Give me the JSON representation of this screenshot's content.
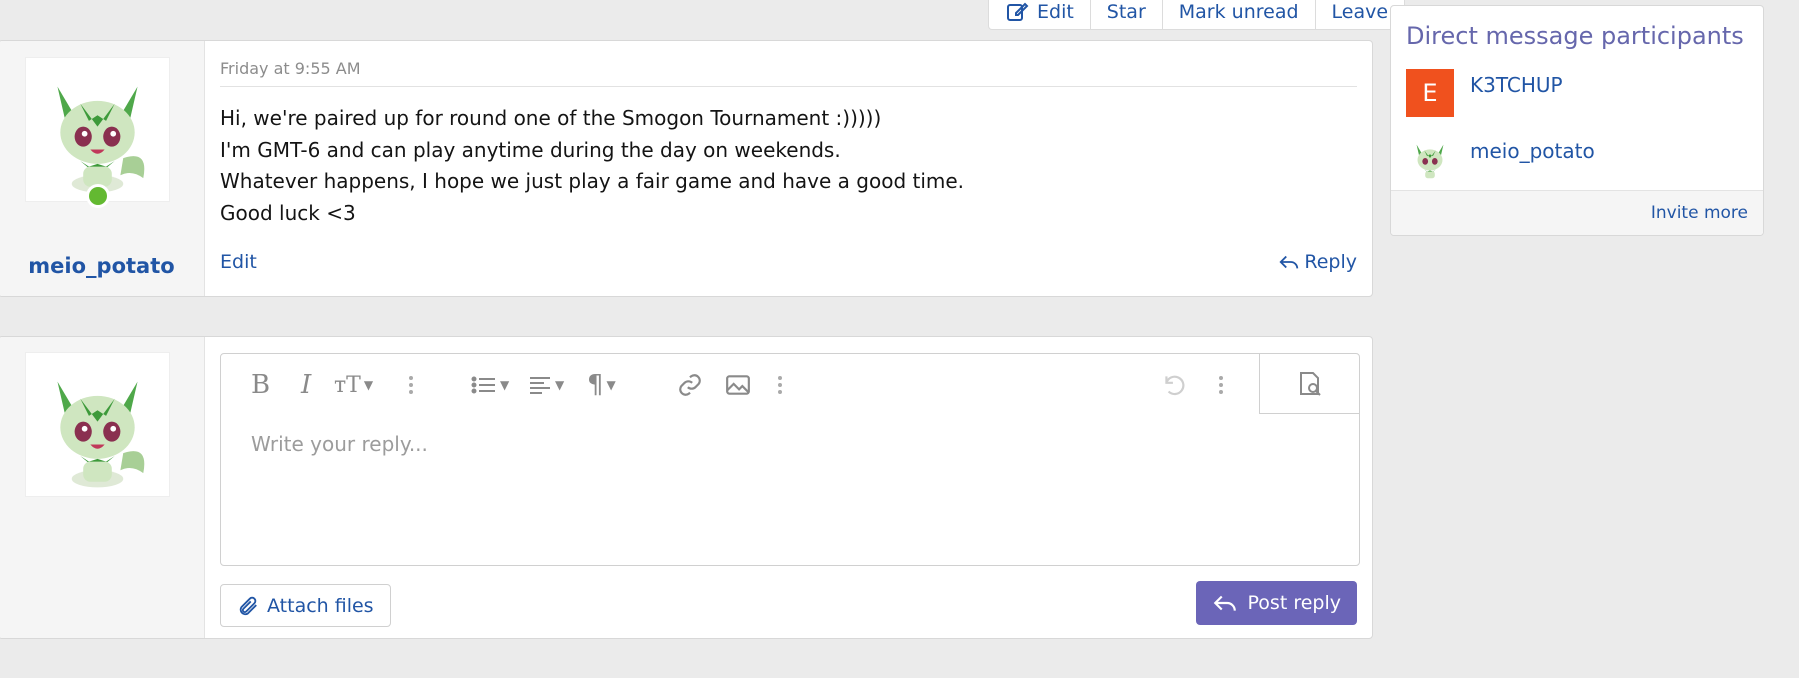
{
  "actions": {
    "edit_label": "Edit",
    "star_label": "Star",
    "mark_unread_label": "Mark unread",
    "leave_label": "Leave"
  },
  "message": {
    "author": "meio_potato",
    "date": "Friday at 9:55 AM",
    "lines": [
      "Hi, we're paired up for round one of the Smogon Tournament :)))))",
      "I'm GMT-6 and can play anytime during the day on weekends.",
      "Whatever happens, I hope we just play a fair game and have a good time.",
      "Good luck <3"
    ],
    "edit_label": "Edit",
    "reply_label": "Reply"
  },
  "reply_box": {
    "placeholder": "Write your reply...",
    "attach_label": "Attach files",
    "post_label": "Post reply",
    "toolbar_icons": [
      "bold-icon",
      "italic-icon",
      "text-size-icon",
      "more-icon",
      "list-icon",
      "align-icon",
      "paragraph-icon",
      "link-icon",
      "image-icon",
      "more-icon",
      "undo-icon",
      "more-icon",
      "preview-icon"
    ]
  },
  "sidebar": {
    "title": "Direct message participants",
    "participants": [
      {
        "name": "K3TCHUP",
        "avatar_letter": "E",
        "avatar_color": "#f0511e"
      },
      {
        "name": "meio_potato",
        "avatar_letter": ""
      }
    ],
    "invite_label": "Invite more"
  },
  "colors": {
    "link": "#2155a5",
    "post_button": "#6b65b8",
    "sidebar_title": "#6667ac",
    "online": "#63b931"
  }
}
